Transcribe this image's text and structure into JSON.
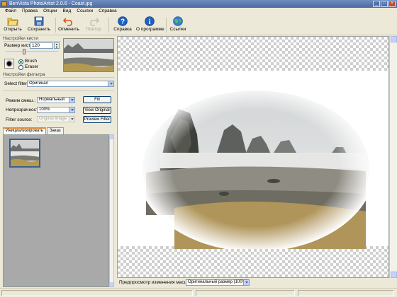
{
  "window": {
    "title": "BenVista PhotoArtist 2.0.6 - Coast.jpg"
  },
  "menu": [
    "Файл",
    "Правка",
    "Опции",
    "Вид",
    "Ссылки",
    "Справка"
  ],
  "toolbar": {
    "open": "Открыть",
    "save": "Сохранить",
    "undo": "Отменить",
    "redo": "Повтор",
    "help": "Справка",
    "about": "О программе",
    "links": "Ссылки"
  },
  "brush_settings": {
    "title": "Настройки кисти",
    "size_label": "Размер кисти:",
    "size_value": "120",
    "size_fraction": 0.42,
    "mode_brush": "Brush",
    "mode_eraser": "Eraser",
    "selected_mode": "Brush"
  },
  "filter_settings": {
    "title": "Настройки фильтра",
    "select_label": "Select filter:",
    "select_value": "Оригинал",
    "blend_label": "Режим смеш.:",
    "blend_value": "Нормальный",
    "opacity_label": "Непрозрачность:",
    "opacity_value": "100%",
    "source_label": "Filter source:",
    "source_value": "Original Image",
    "fill_button": "Fill",
    "view_original_button": "View Original",
    "preview_filter_button": "Preview Filter"
  },
  "tabs": [
    "Инициализировать",
    "Заказ"
  ],
  "active_tab": "Инициализировать",
  "zoom": {
    "label": "Предпросмотр изменения масштаба:",
    "value": "Оригинальный размер (100%)"
  },
  "colors": {
    "titlebar": "#5a7bb4",
    "face": "#ece9d8",
    "help_icon": "#1f5fbf"
  },
  "icons": [
    "open-folder-icon",
    "save-disk-icon",
    "undo-icon",
    "redo-icon",
    "help-icon",
    "info-icon",
    "links-globe-icon"
  ]
}
